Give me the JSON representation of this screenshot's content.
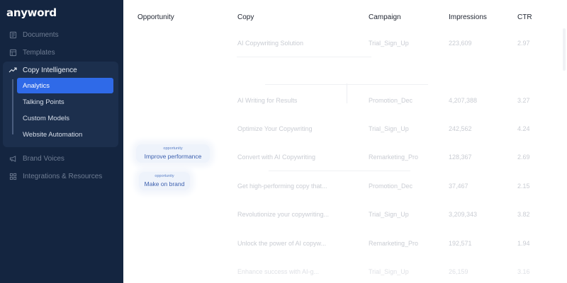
{
  "brand": {
    "logo": "anyword"
  },
  "sidebar": {
    "items_top": [
      {
        "label": "Documents",
        "icon": "document-icon"
      },
      {
        "label": "Templates",
        "icon": "template-icon"
      }
    ],
    "group": {
      "label": "Copy Intelligence",
      "icon": "trend-up-icon",
      "items": [
        {
          "label": "Analytics",
          "active": true
        },
        {
          "label": "Talking Points",
          "active": false
        },
        {
          "label": "Custom Models",
          "active": false
        },
        {
          "label": "Website Automation",
          "active": false
        }
      ]
    },
    "items_bottom": [
      {
        "label": "Brand Voices",
        "icon": "megaphone-icon"
      },
      {
        "label": "Integrations & Resources",
        "icon": "grid-icon"
      }
    ]
  },
  "table": {
    "headers": [
      "Opportunity",
      "Copy",
      "Campaign",
      "Impressions",
      "CTR"
    ],
    "rows": [
      {
        "copy": "AI Copywriting Solution",
        "campaign": "Trial_Sign_Up",
        "impressions": "223,609",
        "ctr": "2.97"
      },
      {
        "copy": "AI Writing for Results",
        "campaign": "Promotion_Dec",
        "impressions": "4,207,388",
        "ctr": "3.27"
      },
      {
        "copy": "Optimize Your Copywriting",
        "campaign": "Trial_Sign_Up",
        "impressions": "242,562",
        "ctr": "4.24"
      },
      {
        "copy": "Convert with AI Copywriting",
        "campaign": "Remarketing_Pro",
        "impressions": "128,367",
        "ctr": "2.69"
      },
      {
        "copy": "Get high-performing copy that...",
        "campaign": "Promotion_Dec",
        "impressions": "37,467",
        "ctr": "2.15"
      },
      {
        "copy": "Revolutionize your copywriting...",
        "campaign": "Trial_Sign_Up",
        "impressions": "3,209,343",
        "ctr": "3.82"
      },
      {
        "copy": "Unlock the power of AI copyw...",
        "campaign": "Remarketing_Pro",
        "impressions": "192,571",
        "ctr": "1.94"
      },
      {
        "copy": "Enhance success with AI-g...",
        "campaign": "Trial_Sign_Up",
        "impressions": "26,159",
        "ctr": "3.16"
      }
    ]
  },
  "opportunity_tags": [
    {
      "small": "opportunity",
      "label": "Improve performance"
    },
    {
      "small": "opportunity",
      "label": "Make on brand"
    }
  ],
  "colors": {
    "sidebar_bg": "#142540",
    "active_item": "#2f6ae8",
    "tag_text": "#3b5fae"
  }
}
